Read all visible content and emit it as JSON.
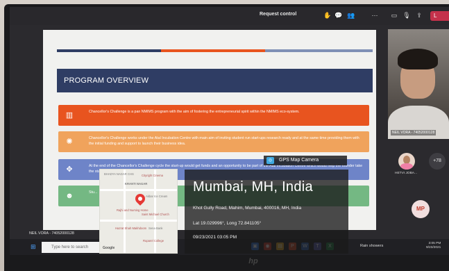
{
  "meeting": {
    "request_control": "Request control",
    "leave_label": "L"
  },
  "slide": {
    "title": "PROGRAM OVERVIEW",
    "stripe_colors": [
      "#2f3d64",
      "#e8541f",
      "#7f8fb5"
    ],
    "rows": [
      {
        "text": "Chancellor's Challenge is a pan NMIMS program with the aim of fostering the entrepreneurial spirit within the NMIMS eco-system.",
        "color": "#e8541f",
        "icon": "bar-chart-icon"
      },
      {
        "text": "Chancellor's Challenge works under the Atal Incubation Centre with main aim of inviting student run start-ups research ready and at the same time providing them with the initial funding and support to launch their business idea.",
        "color": "#f0a35c",
        "icon": "lightbulb-icon"
      },
      {
        "text": "At the end of the Chancellor's Challenge cycle the start-up would get funds and an opportunity to be part of the Atal Incubation Centre which would help the founder take the start-up to the next level.",
        "color": "#6e84c8",
        "icon": "handshake-icon"
      },
      {
        "text": "Stu...",
        "color": "#74b883",
        "icon": "people-icon"
      }
    ]
  },
  "participants": {
    "self_name": "NEIL VORA - 74052000128",
    "hetvi_name": "HETVI JOBA...",
    "more_count": "+78",
    "mp_initials": "MP",
    "presenter_label": "NEIL VORA - 74052000128"
  },
  "taskbar": {
    "search_placeholder": "Type here to search",
    "weather": "Rain showers",
    "time": "3:05 PM",
    "date": "9/23/2021"
  },
  "gps": {
    "app_name": "GPS Map Camera",
    "city": "Mumbai, MH, India",
    "address": "Khot Gully Road, Mahim, Mumbai, 400016, MH, India",
    "coords": "Lat 19.029996°, Long 72.841105°",
    "datetime": "09/23/2021 03:05 PM",
    "map_labels": [
      "BHADYA NAGAR CHS",
      "KRANTI NAGAR",
      "Cityright Cinema",
      "Akbar Ice Cream",
      "Rajhi and Nursing Home",
      "Saint Michael Church",
      "Sena Bank",
      "Hazrat Shah Makhdoom",
      "Ruparel College"
    ],
    "map_credit": "Google"
  }
}
